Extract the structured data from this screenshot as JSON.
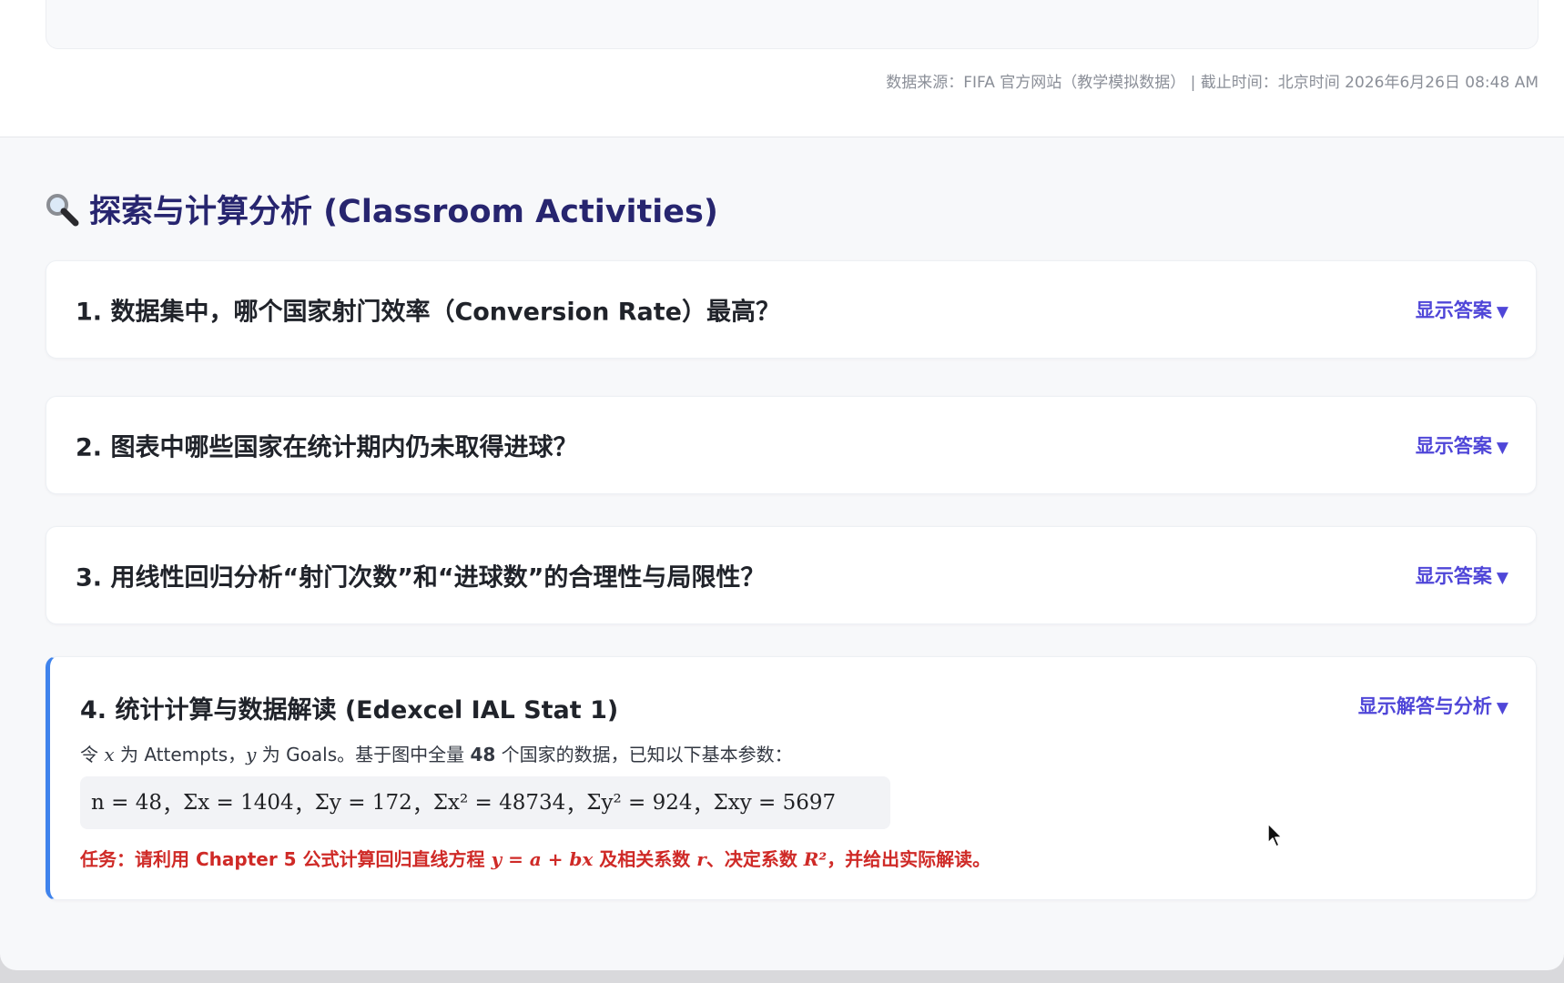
{
  "header": {
    "source_line": "数据来源：FIFA 官方网站（教学模拟数据） | 截止时间：北京时间 2026年6月26日 08:48 AM"
  },
  "section": {
    "title": "探索与计算分析 (Classroom Activities)",
    "icon": "magnifier-icon"
  },
  "questions": [
    {
      "text": "1. 数据集中，哪个国家射门效率（Conversion Rate）最高？",
      "toggle": "显示答案"
    },
    {
      "text": "2. 图表中哪些国家在统计期内仍未取得进球？",
      "toggle": "显示答案"
    },
    {
      "text": "3. 用线性回归分析“射门次数”和“进球数”的合理性与局限性？",
      "toggle": "显示答案"
    }
  ],
  "stat_card": {
    "title": "4. 统计计算与数据解读 (Edexcel IAL Stat 1)",
    "toggle": "显示解答与分析",
    "intro": {
      "p1": "令 ",
      "x": "x",
      "p2": " 为 Attempts，",
      "y": "y",
      "p3": " 为 Goals。基于图中全量 ",
      "count": "48",
      "p4": " 个国家的数据，已知以下基本参数："
    },
    "formula": {
      "n": "n = 48",
      "sum_x": "Σx = 1404",
      "sum_y": "Σy = 172",
      "sum_x2": "Σx² = 48734",
      "sum_y2": "Σy² = 924",
      "sum_xy": "Σxy = 5697",
      "separator": "，"
    },
    "task": {
      "p1": "任务：请利用 Chapter 5 公式计算回归直线方程 ",
      "eq": "y = a + bx",
      "p2": " 及相关系数 ",
      "r": "r",
      "p3": "、决定系数 ",
      "r2": "R²",
      "p4": "，并给出实际解读。"
    }
  },
  "arrow_glyph": "▼",
  "colors": {
    "title": "#27256f",
    "link": "#4f46d8",
    "accent_border": "#3f83ec",
    "task_red": "#cf2a27"
  }
}
